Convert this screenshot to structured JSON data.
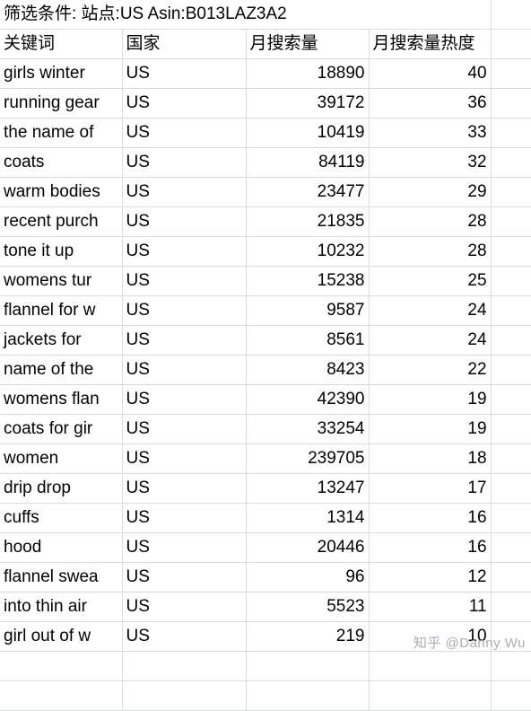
{
  "sheet": {
    "filter_title": "筛选条件: 站点:US Asin:B013LAZ3A2",
    "columns": [
      "关键词",
      "国家",
      "月搜索量",
      "月搜索量热度"
    ],
    "rows": [
      {
        "keyword": "girls winter",
        "country": "US",
        "volume": "18890",
        "heat": "40"
      },
      {
        "keyword": "running gear",
        "country": "US",
        "volume": "39172",
        "heat": "36"
      },
      {
        "keyword": "the name of",
        "country": "US",
        "volume": "10419",
        "heat": "33"
      },
      {
        "keyword": "coats",
        "country": "US",
        "volume": "84119",
        "heat": "32"
      },
      {
        "keyword": "warm bodies",
        "country": "US",
        "volume": "23477",
        "heat": "29"
      },
      {
        "keyword": "recent purch",
        "country": "US",
        "volume": "21835",
        "heat": "28"
      },
      {
        "keyword": "tone it up",
        "country": "US",
        "volume": "10232",
        "heat": "28"
      },
      {
        "keyword": "womens tur",
        "country": "US",
        "volume": "15238",
        "heat": "25"
      },
      {
        "keyword": "flannel for w",
        "country": "US",
        "volume": "9587",
        "heat": "24"
      },
      {
        "keyword": "jackets for",
        "country": "US",
        "volume": "8561",
        "heat": "24"
      },
      {
        "keyword": "name of the",
        "country": "US",
        "volume": "8423",
        "heat": "22"
      },
      {
        "keyword": "womens flan",
        "country": "US",
        "volume": "42390",
        "heat": "19"
      },
      {
        "keyword": "coats for gir",
        "country": "US",
        "volume": "33254",
        "heat": "19"
      },
      {
        "keyword": "women",
        "country": "US",
        "volume": "239705",
        "heat": "18"
      },
      {
        "keyword": "drip drop",
        "country": "US",
        "volume": "13247",
        "heat": "17"
      },
      {
        "keyword": "cuffs",
        "country": "US",
        "volume": "1314",
        "heat": "16"
      },
      {
        "keyword": "hood",
        "country": "US",
        "volume": "20446",
        "heat": "16"
      },
      {
        "keyword": "flannel swea",
        "country": "US",
        "volume": "96",
        "heat": "12"
      },
      {
        "keyword": "into thin air",
        "country": "US",
        "volume": "5523",
        "heat": "11"
      },
      {
        "keyword": "girl out of w",
        "country": "US",
        "volume": "219",
        "heat": "10"
      }
    ],
    "watermark": "知乎 @Danny Wu"
  }
}
